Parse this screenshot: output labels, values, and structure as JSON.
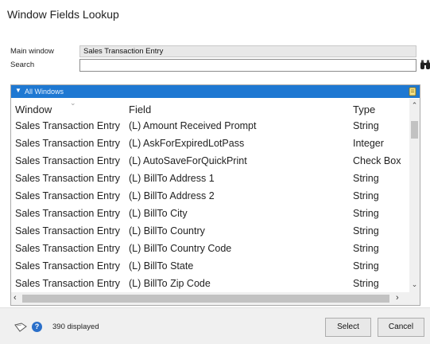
{
  "window": {
    "title": "Window Fields Lookup"
  },
  "form": {
    "main_window_label": "Main window",
    "main_window_value": "Sales Transaction Entry",
    "search_label": "Search",
    "search_value": "",
    "search_icon": "binoculars-icon"
  },
  "grid": {
    "group_label": "All Windows",
    "columns": {
      "window": "Window",
      "field": "Field",
      "type": "Type"
    },
    "rows": [
      {
        "window": "Sales Transaction Entry",
        "field": "(L) Amount Received Prompt",
        "type": "String"
      },
      {
        "window": "Sales Transaction Entry",
        "field": "(L) AskForExpiredLotPass",
        "type": "Integer"
      },
      {
        "window": "Sales Transaction Entry",
        "field": "(L) AutoSaveForQuickPrint",
        "type": "Check Box"
      },
      {
        "window": "Sales Transaction Entry",
        "field": "(L) BillTo Address 1",
        "type": "String"
      },
      {
        "window": "Sales Transaction Entry",
        "field": "(L) BillTo Address 2",
        "type": "String"
      },
      {
        "window": "Sales Transaction Entry",
        "field": "(L) BillTo City",
        "type": "String"
      },
      {
        "window": "Sales Transaction Entry",
        "field": "(L) BillTo Country",
        "type": "String"
      },
      {
        "window": "Sales Transaction Entry",
        "field": "(L) BillTo Country Code",
        "type": "String"
      },
      {
        "window": "Sales Transaction Entry",
        "field": "(L) BillTo State",
        "type": "String"
      },
      {
        "window": "Sales Transaction Entry",
        "field": "(L) BillTo Zip Code",
        "type": "String"
      }
    ]
  },
  "footer": {
    "count_text": "390 displayed",
    "select_label": "Select",
    "cancel_label": "Cancel"
  },
  "colors": {
    "group_bar": "#1e78d2",
    "help_icon": "#2a6fc9"
  }
}
